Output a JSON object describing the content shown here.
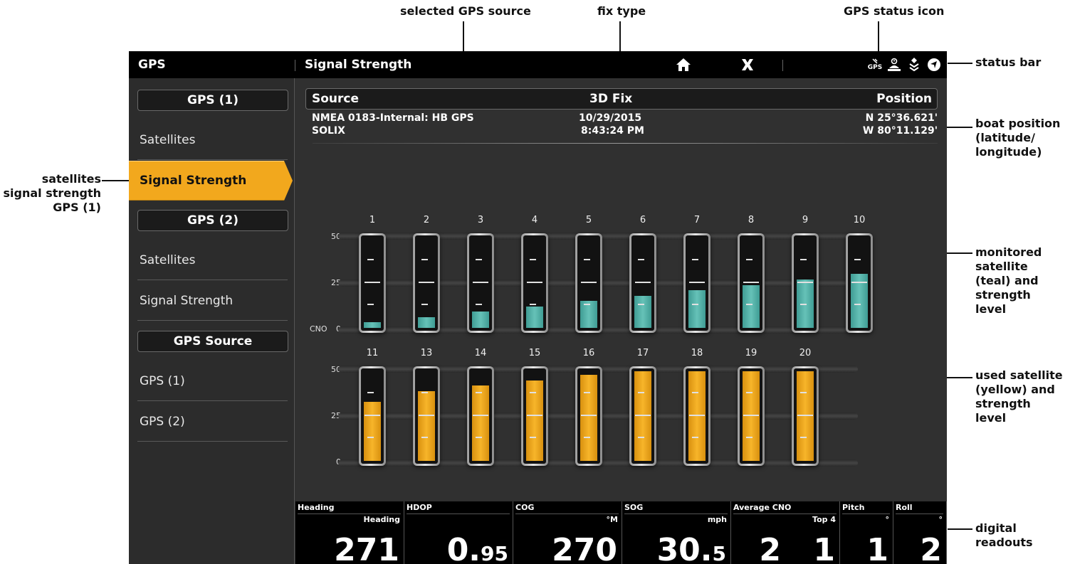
{
  "callouts": {
    "selected_gps_source": "selected GPS source",
    "fix_type": "fix type",
    "gps_status_icon": "GPS status icon",
    "status_bar": "status bar",
    "boat_position": [
      "boat position",
      "(latitude/",
      "longitude)"
    ],
    "left_menu": [
      "satellites",
      "signal strength",
      "GPS (1)"
    ],
    "monitored": [
      "monitored",
      "satellite",
      "(teal) and",
      "strength",
      "level"
    ],
    "used": [
      "used satellite",
      "(yellow) and",
      "strength",
      "level"
    ],
    "digital_readouts": [
      "digital",
      "readouts"
    ]
  },
  "statusbar": {
    "app_title": "GPS",
    "view_title": "Signal Strength",
    "icons": [
      "home-icon",
      "close-icon",
      "gps-status-icon",
      "alarm-icon",
      "layers-icon",
      "navigation-icon"
    ],
    "gps_icon_text": "GPS"
  },
  "sidebar": {
    "heading1": "GPS (1)",
    "gps1_items": [
      "Satellites",
      "Signal Strength"
    ],
    "heading2": "GPS (2)",
    "gps2_items": [
      "Satellites",
      "Signal Strength"
    ],
    "heading3": "GPS Source",
    "source_items": [
      "GPS (1)",
      "GPS (2)"
    ],
    "active_item": "Signal Strength"
  },
  "info": {
    "source_label": "Source",
    "fix_label": "3D Fix",
    "position_label": "Position",
    "source_line1": "NMEA 0183-Internal: HB GPS",
    "source_line2": "SOLIX",
    "date": "10/29/2015",
    "time": "8:43:24 PM",
    "latitude": "N 25°36.621'",
    "longitude": "W 80°11.129'"
  },
  "chart_data": {
    "type": "bar",
    "axis": {
      "min": 0,
      "max": 50,
      "ticks": [
        "50",
        "25",
        "0"
      ],
      "ylabel": "CNO"
    },
    "monitored_color": "#5fbab0",
    "used_color": "#f2a81d",
    "monitored": {
      "categories": [
        "1",
        "2",
        "3",
        "4",
        "5",
        "6",
        "7",
        "8",
        "9",
        "10"
      ],
      "values": [
        3,
        6,
        9,
        12,
        15,
        18,
        21,
        24,
        27,
        30
      ]
    },
    "used": {
      "categories": [
        "11",
        "13",
        "14",
        "15",
        "16",
        "17",
        "18",
        "19",
        "20"
      ],
      "values": [
        33,
        39,
        42,
        45,
        48,
        50,
        50,
        50,
        50
      ]
    }
  },
  "readouts": [
    {
      "label": "Heading",
      "unit": "Heading",
      "value": "271",
      "decimal": ""
    },
    {
      "label": "HDOP",
      "unit": "",
      "value": "0.",
      "decimal": "95"
    },
    {
      "label": "COG",
      "unit": "°M",
      "value": "270",
      "decimal": ""
    },
    {
      "label": "SOG",
      "unit": "mph",
      "value": "30.",
      "decimal": "5"
    },
    {
      "label": "Average CNO",
      "unit": "Top 4",
      "value": "2",
      "value2": "1",
      "decimal": ""
    },
    {
      "label": "Pitch",
      "unit": "°",
      "value": "1",
      "decimal": ""
    },
    {
      "label": "Roll",
      "unit": "°",
      "value": "2",
      "decimal": ""
    }
  ]
}
